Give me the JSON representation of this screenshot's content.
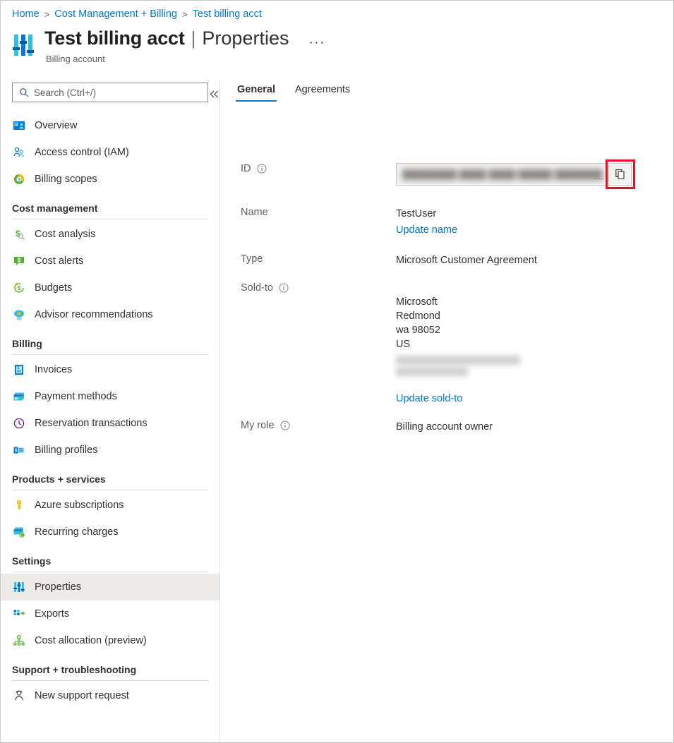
{
  "breadcrumb": {
    "items": [
      {
        "label": "Home"
      },
      {
        "label": "Cost Management + Billing"
      },
      {
        "label": "Test billing acct"
      }
    ],
    "separator": ">"
  },
  "header": {
    "logo_icon": "properties-sliders-icon",
    "title": "Test billing acct",
    "title_separator": "|",
    "subtitle": "Properties",
    "more_label": "···",
    "caption": "Billing account"
  },
  "search": {
    "placeholder": "Search (Ctrl+/)",
    "value": "",
    "icon": "search-icon"
  },
  "sidebar": {
    "collapse_icon": "chevron-double-left-icon",
    "top_items": [
      {
        "label": "Overview",
        "icon": "overview-icon"
      },
      {
        "label": "Access control (IAM)",
        "icon": "people-icon"
      },
      {
        "label": "Billing scopes",
        "icon": "billing-scopes-icon"
      }
    ],
    "groups": [
      {
        "title": "Cost management",
        "items": [
          {
            "label": "Cost analysis",
            "icon": "cost-analysis-icon"
          },
          {
            "label": "Cost alerts",
            "icon": "cost-alerts-icon"
          },
          {
            "label": "Budgets",
            "icon": "budgets-icon"
          },
          {
            "label": "Advisor recommendations",
            "icon": "advisor-icon"
          }
        ]
      },
      {
        "title": "Billing",
        "items": [
          {
            "label": "Invoices",
            "icon": "invoice-icon"
          },
          {
            "label": "Payment methods",
            "icon": "credit-card-icon"
          },
          {
            "label": "Reservation transactions",
            "icon": "clock-icon"
          },
          {
            "label": "Billing profiles",
            "icon": "billing-profile-icon"
          }
        ]
      },
      {
        "title": "Products + services",
        "items": [
          {
            "label": "Azure subscriptions",
            "icon": "key-icon"
          },
          {
            "label": "Recurring charges",
            "icon": "recurring-charges-icon"
          }
        ]
      },
      {
        "title": "Settings",
        "items": [
          {
            "label": "Properties",
            "icon": "properties-sliders-icon",
            "selected": true
          },
          {
            "label": "Exports",
            "icon": "exports-icon"
          },
          {
            "label": "Cost allocation (preview)",
            "icon": "cost-allocation-icon"
          }
        ]
      },
      {
        "title": "Support + troubleshooting",
        "items": [
          {
            "label": "New support request",
            "icon": "support-person-icon"
          }
        ]
      }
    ]
  },
  "main": {
    "tabs": [
      {
        "label": "General",
        "active": true
      },
      {
        "label": "Agreements",
        "active": false
      }
    ],
    "properties": {
      "id": {
        "label": "ID",
        "has_info": true,
        "value_redacted": "████████ ████ ████ █████ ██████████",
        "overflow_indicator": "...",
        "copy_icon": "copy-icon",
        "copy_highlighted": true
      },
      "name": {
        "label": "Name",
        "has_info": false,
        "value": "TestUser",
        "link_label": "Update name"
      },
      "type": {
        "label": "Type",
        "has_info": false,
        "value": "Microsoft Customer Agreement"
      },
      "sold_to": {
        "label": "Sold-to",
        "has_info": true,
        "lines": [
          "Microsoft",
          "Redmond",
          "wa 98052",
          "US"
        ],
        "redacted_lines": 2,
        "link_label": "Update sold-to"
      },
      "my_role": {
        "label": "My role",
        "has_info": true,
        "value": "Billing account owner"
      }
    }
  },
  "colors": {
    "accent": "#0078d4",
    "highlight": "#e81123",
    "text": "#323130",
    "muted": "#605e5c"
  }
}
